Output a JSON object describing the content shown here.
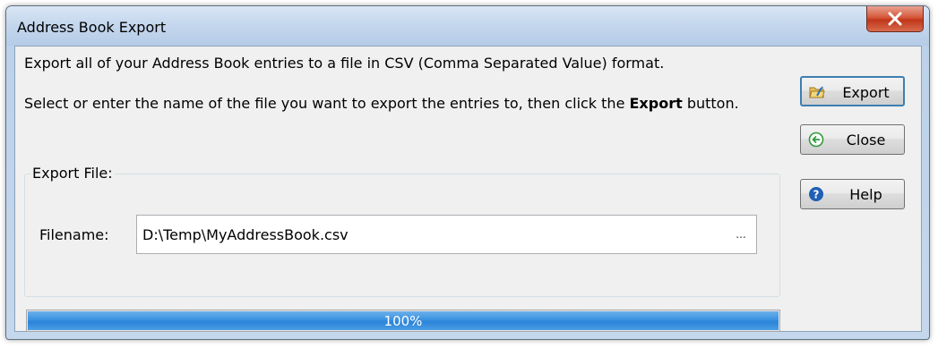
{
  "window": {
    "title": "Address Book Export"
  },
  "content": {
    "intro": "Export all of your Address Book entries to a file in CSV (Comma Separated Value) format.",
    "instruction_before": "Select or enter the name of the file you want to export the entries to, then click the ",
    "instruction_bold": "Export",
    "instruction_after": " button."
  },
  "export_file": {
    "group_label": "Export File:",
    "filename_label": "Filename:",
    "filename_value": "D:\\Temp\\MyAddressBook.csv",
    "browse_label": "..."
  },
  "progress": {
    "value": 100,
    "text": "100%"
  },
  "buttons": {
    "export": "Export",
    "close": "Close",
    "help": "Help"
  },
  "colors": {
    "progress_fill": "#3a92e0",
    "close_button": "#c0361a"
  }
}
